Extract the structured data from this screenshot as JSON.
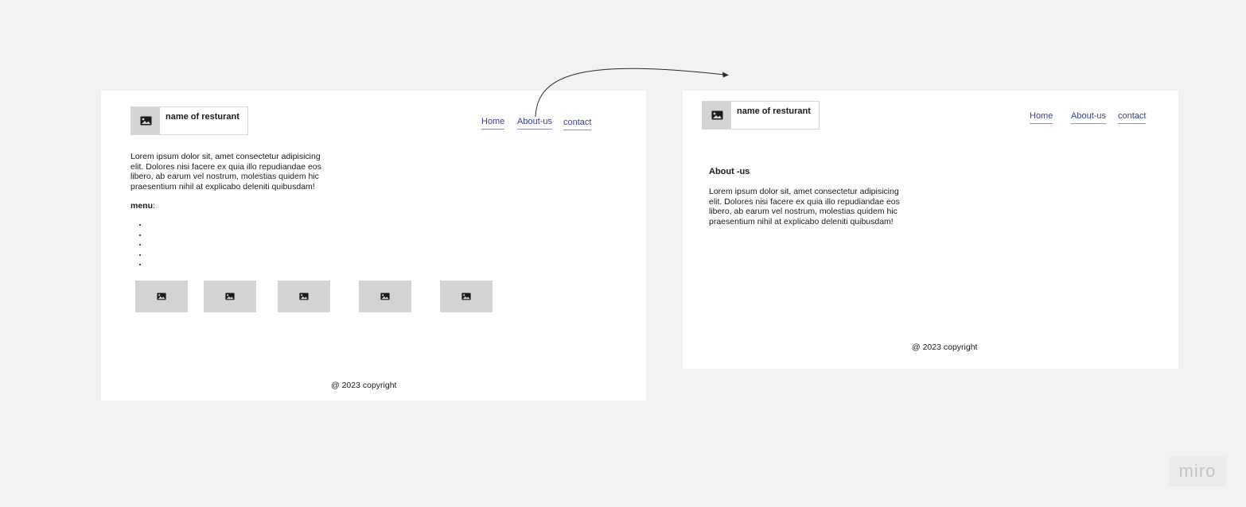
{
  "home_page": {
    "logo": {
      "icon": "image-icon",
      "name": "name of resturant"
    },
    "nav": [
      "Home",
      "About-us",
      "contact"
    ],
    "intro": "Lorem ipsum dolor sit, amet consectetur adipisicing elit. Dolores nisi facere ex quia illo repudiandae eos libero, ab earum vel nostrum, molestias quidem hic praesentium nihil at explicabo deleniti quibusdam!",
    "menu_label": "menu",
    "menu_suffix": ":",
    "menu_item_count": 5,
    "gallery_count": 5,
    "gallery_icon": "image-icon",
    "footer": "@ 2023 copyright"
  },
  "about_page": {
    "logo": {
      "icon": "image-icon",
      "name": "name of resturant"
    },
    "nav": [
      "Home",
      "About-us",
      "contact"
    ],
    "heading": "About -us",
    "body": "Lorem ipsum dolor sit, amet consectetur adipisicing elit. Dolores nisi facere ex quia illo repudiandae eos libero, ab earum vel nostrum, molestias quidem hic praesentium nihil at explicabo deleniti quibusdam!",
    "footer": "@ 2023 copyright"
  },
  "watermark": "miro",
  "colors": {
    "canvas": "#f2f2f2",
    "frame": "#ffffff",
    "placeholder": "#d3d3d3",
    "link": "#3b3f8f",
    "link_underline": "#8c8fd0"
  }
}
